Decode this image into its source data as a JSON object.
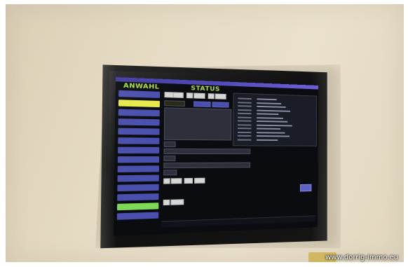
{
  "screen": {
    "menu_title": "ANWAHL",
    "status_title": "STATUS",
    "menu_buttons": [
      {
        "color": "#4b4fae"
      },
      {
        "color": "#e8e94a"
      },
      {
        "color": "#4b4fae"
      },
      {
        "color": "#4b4fae"
      },
      {
        "color": "#4b4fae"
      },
      {
        "color": "#4b4fae"
      },
      {
        "color": "#4b4fae"
      },
      {
        "color": "#4b4fae"
      },
      {
        "color": "#4b4fae"
      },
      {
        "color": "#4b4fae"
      },
      {
        "color": "#4b4fae"
      },
      {
        "color": "#4b4fae"
      },
      {
        "color": "#7ed957"
      },
      {
        "color": "#4b4fae"
      }
    ],
    "colors": {
      "title_bar": "#5a52c8",
      "heading": "#a9e04a",
      "menu_button": "#4b4fae",
      "highlight_yellow": "#e8e94a",
      "highlight_green": "#7ed957",
      "screen_bg": "#0b0c10"
    }
  },
  "watermark": "www.dorrig-immo.eu"
}
